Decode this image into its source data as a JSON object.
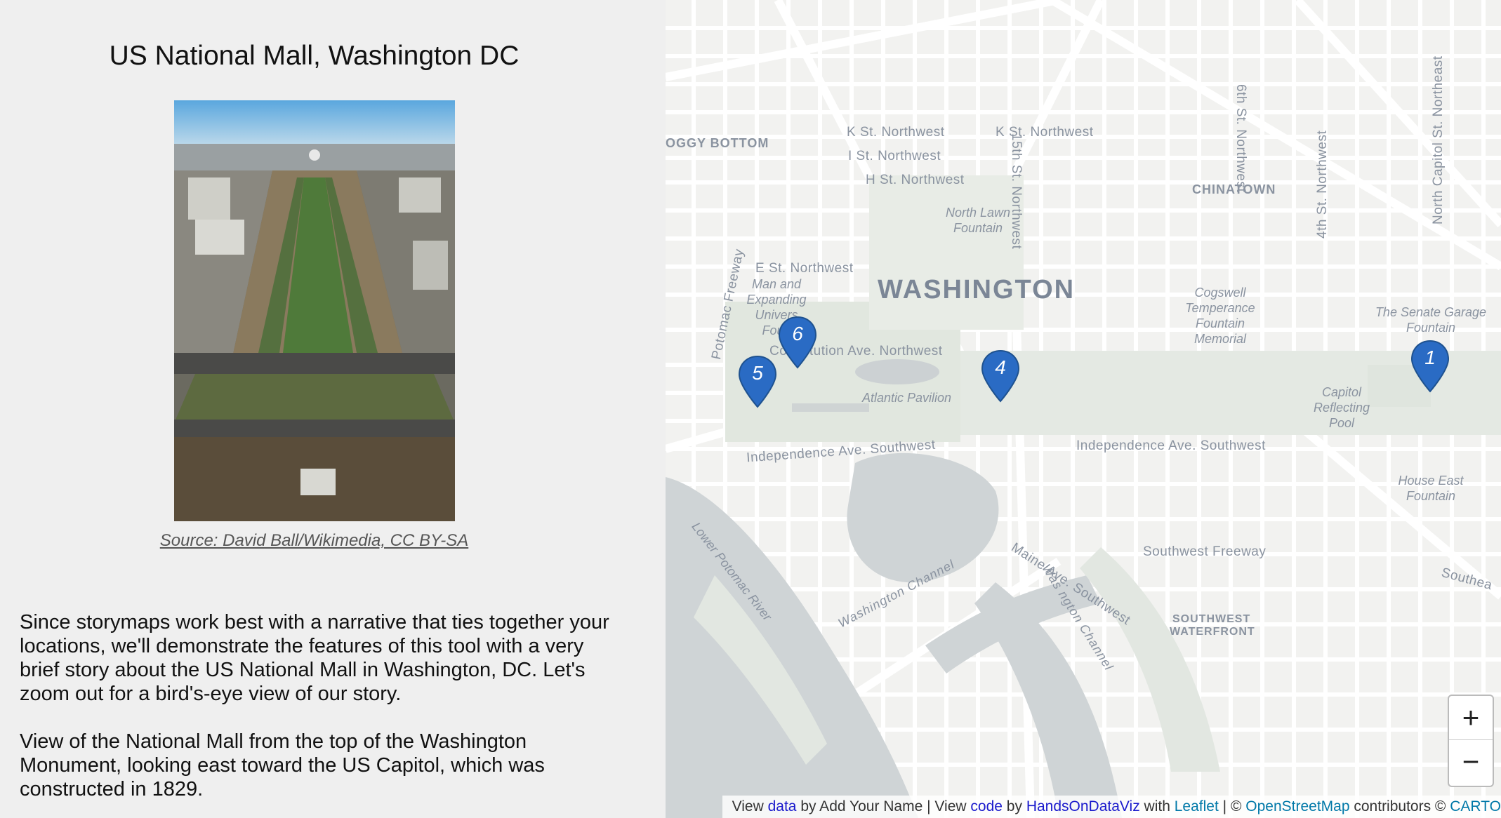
{
  "story": {
    "title": "US National Mall, Washington DC",
    "image_source": "Source: David Ball/Wikimedia, CC BY-SA",
    "paragraph_1": "Since storymaps work best with a narrative that ties together your locations, we'll demonstrate the features of this tool with a very brief story about the US National Mall in Washington, DC. Let's zoom out for a bird's-eye view of our story.",
    "paragraph_2": "View of the National Mall from the top of the Washington Monument, looking east toward the US Capitol, which was constructed in 1829."
  },
  "map": {
    "city_label": "WASHINGTON",
    "neighborhoods": [
      "OGGY BOTTOM",
      "CHINATOWN",
      "SOUTHWEST",
      "WATERFRONT"
    ],
    "streets": {
      "k_st_1": "K St. Northwest",
      "k_st_2": "K St. Northwest",
      "i_st": "I St. Northwest",
      "h_st": "H St. Northwest",
      "e_st": "E St. Northwest",
      "constitution": "Constitution Ave. Northwest",
      "independence_1": "Independence Ave. Southwest",
      "independence_2": "Independence Ave. Southwest",
      "maine": "Maine Ave. Southwest",
      "sw_freeway": "Southwest Freeway",
      "sixth": "6th St. Northwest",
      "fifteenth": "15th St. Northwest",
      "fourth": "4th St. Northwest",
      "north_capitol": "North Capitol St. Northeast",
      "potomac_fwy": "Potomac Freeway",
      "southeast": "Southea"
    },
    "pois": {
      "north_lawn": "North Lawn Fountain",
      "man_expanding": "Man and Expanding Univers Foun",
      "atlantic": "Atlantic Pavilion",
      "cogswell": "Cogswell Temperance Fountain Memorial",
      "senate_garage": "The Senate Garage Fountain",
      "reflecting_pool": "Capitol Reflecting Pool",
      "house_east": "House East Fountain"
    },
    "water": {
      "lower_potomac": "Lower Potomac River",
      "washington_channel": "Washington Channel",
      "washington_channel_2": "Was    ngton Channel"
    },
    "markers": [
      {
        "number": "1",
        "color": "#2a6bc4"
      },
      {
        "number": "4",
        "color": "#2a6bc4"
      },
      {
        "number": "5",
        "color": "#2a6bc4"
      },
      {
        "number": "6",
        "color": "#2a6bc4"
      }
    ],
    "zoom_in": "+",
    "zoom_out": "−",
    "attribution": {
      "view1": "View",
      "data_link": "data",
      "by1": "by Add Your Name | View",
      "code_link": "code",
      "by2": "by",
      "hodv_link": "HandsOnDataViz",
      "with": "with",
      "leaflet_link": "Leaflet",
      "sep": "| ©",
      "osm_link": "OpenStreetMap",
      "contrib": "contributors ©",
      "carto_link": "CARTO"
    }
  }
}
